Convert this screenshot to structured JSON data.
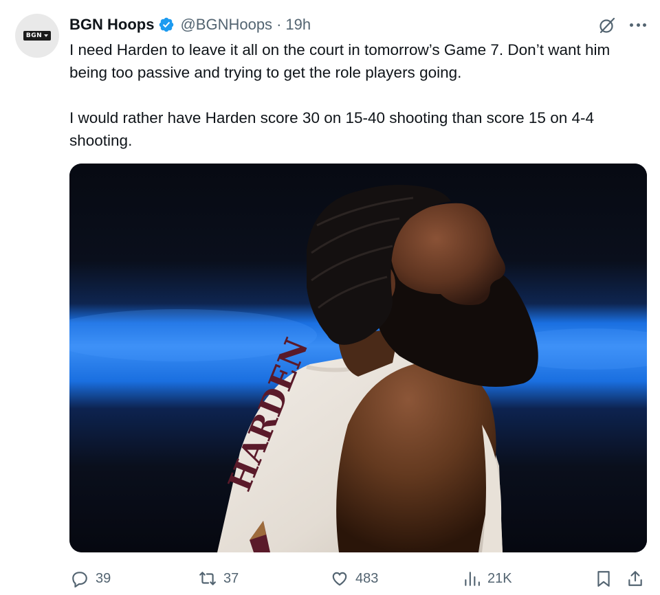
{
  "tweet": {
    "author_name": "BGN Hoops",
    "handle": "@BGNHoops",
    "separator": "·",
    "time": "19h",
    "avatar_text": "BGN",
    "paragraphs": [
      "I need Harden to leave it all on the court in tomorrow’s Game 7. Don’t want him being too passive and trying to get the role players going.",
      "I would rather have Harden score 30 on 15-40 shooting than score 15 on 4-4 shooting."
    ],
    "jersey_text": "HARDEN",
    "media_alt": "basketball player with braids and beard in white jersey"
  },
  "metrics": {
    "replies": "39",
    "retweets": "37",
    "likes": "483",
    "views": "21K"
  },
  "icons": {
    "verified": "verified-badge-icon",
    "grok": "grok-icon",
    "more": "more-icon",
    "reply": "reply-icon",
    "retweet": "retweet-icon",
    "like": "like-icon",
    "views": "views-icon",
    "bookmark": "bookmark-icon",
    "share": "share-icon"
  },
  "colors": {
    "verified_blue": "#1d9bf0",
    "text_primary": "#0f1419",
    "text_secondary": "#536471",
    "arena_blue": "#1a6fe0"
  }
}
